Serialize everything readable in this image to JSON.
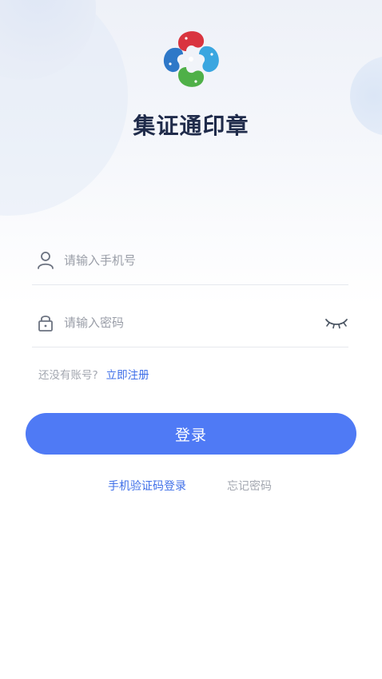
{
  "brand": {
    "app_name": "集证通印章",
    "logo_colors": [
      "#d9343f",
      "#2e8fd6",
      "#4fb048",
      "#3a8fd0"
    ]
  },
  "form": {
    "phone_placeholder": "请输入手机号",
    "password_placeholder": "请输入密码",
    "user_icon": "user-icon",
    "lock_icon": "lock-icon",
    "eye_icon": "eye-closed-icon"
  },
  "register": {
    "question": "还没有账号?",
    "link": "立即注册"
  },
  "login_button": "登录",
  "footer_links": {
    "sms_login": "手机验证码登录",
    "forgot_password": "忘记密码"
  },
  "colors": {
    "accent": "#4f7af5",
    "link": "#3f6fe8",
    "muted": "#a3a7b0",
    "title": "#1f2b4a"
  }
}
